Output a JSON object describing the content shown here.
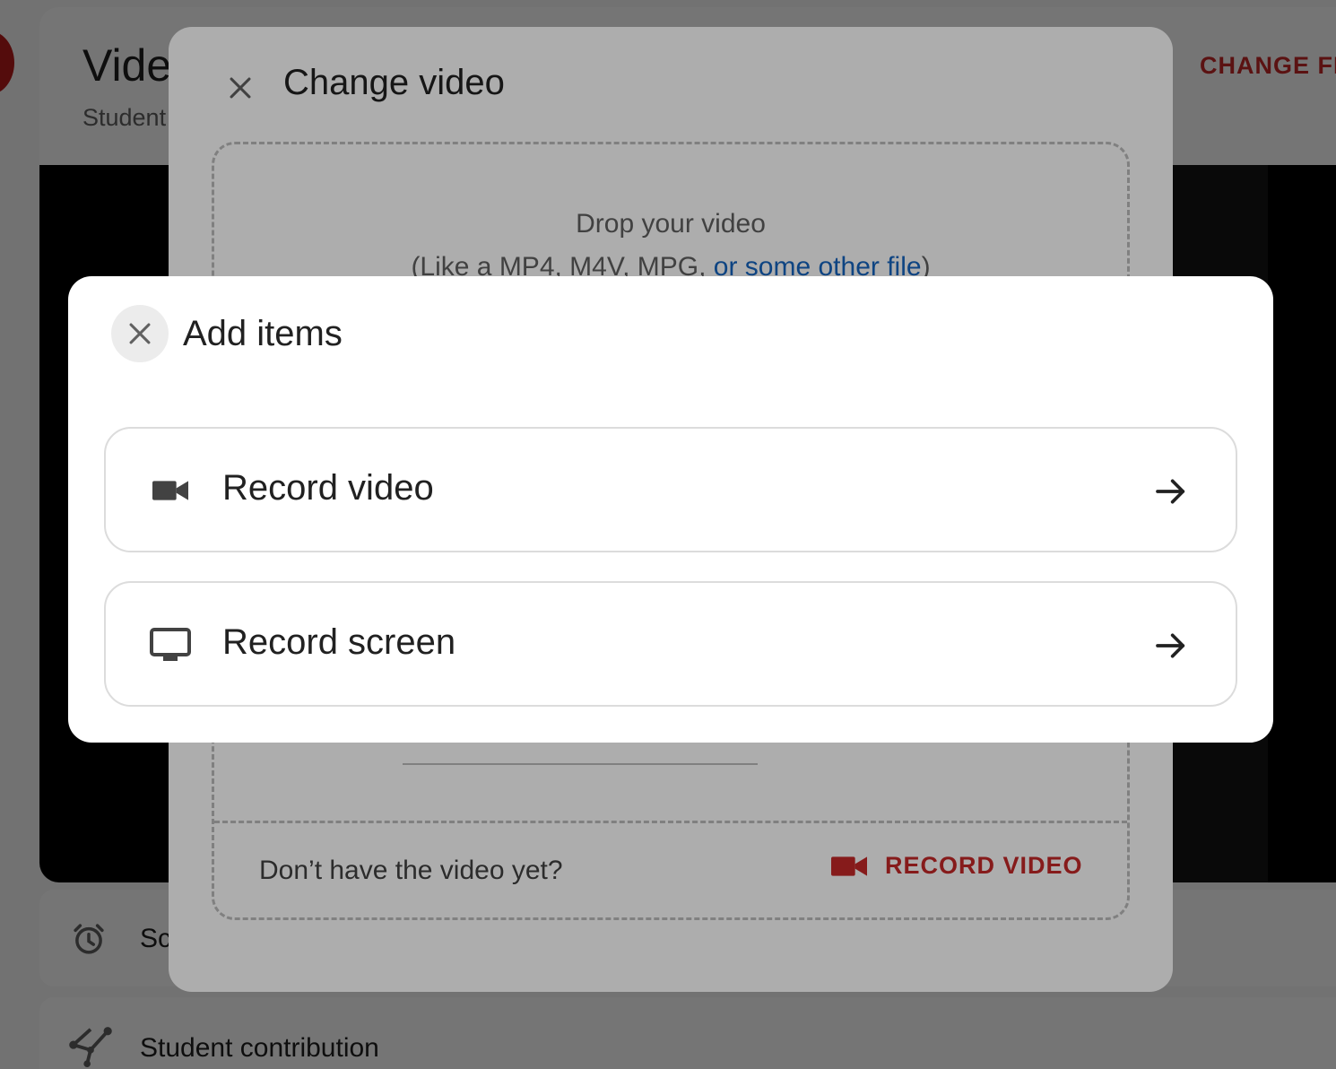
{
  "colors": {
    "accent_red": "#c62828",
    "link_blue": "#1565c0",
    "scrim": "rgba(0,0,0,0.32)"
  },
  "background": {
    "page_title": "Vide",
    "page_subtitle": "Student",
    "change_file_label": "CHANGE FI",
    "settings_label": "Sc",
    "settings_icon": "alarm-icon",
    "contribution_label": "Student contribution",
    "contribution_icon": "share-nodes-icon"
  },
  "change_dialog": {
    "title": "Change video",
    "close_icon": "close-icon",
    "dropzone": {
      "headline": "Drop your video",
      "types_prefix": "(Like a MP4, M4V, MPG, ",
      "types_link": "or some other file",
      "types_suffix": ")",
      "prompt": "Don’t have the video yet?",
      "record_label": "RECORD VIDEO",
      "record_icon": "videocam-icon"
    }
  },
  "add_items_dialog": {
    "title": "Add items",
    "close_icon": "close-icon",
    "options": [
      {
        "label": "Record video",
        "icon": "videocam-icon",
        "trailing_icon": "arrow-right-icon"
      },
      {
        "label": "Record screen",
        "icon": "monitor-icon",
        "trailing_icon": "arrow-right-icon"
      }
    ]
  }
}
